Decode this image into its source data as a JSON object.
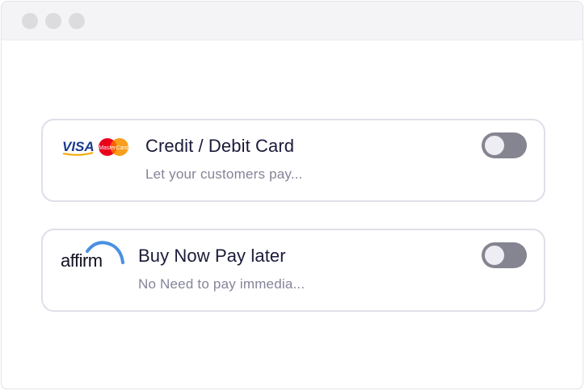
{
  "window": {
    "controls": [
      "close",
      "minimize",
      "maximize"
    ]
  },
  "payment_methods": [
    {
      "title": "Credit / Debit Card",
      "description": "Let your customers pay...",
      "logo": "visa-mastercard-logo",
      "logo_text": {
        "visa": "VISA",
        "mastercard": "MasterCard"
      },
      "enabled": false
    },
    {
      "title": "Buy Now Pay later",
      "description": "No Need to pay immedia...",
      "logo": "affirm-logo",
      "logo_text": {
        "affirm": "affirm"
      },
      "enabled": false
    }
  ],
  "colors": {
    "toggle_off": "#858591",
    "title_text": "#1a1a3a",
    "description_text": "#84849a",
    "visa_blue": "#1a3a8f",
    "visa_gold": "#f2a900",
    "mastercard_red": "#eb001b",
    "mastercard_orange": "#f79e1b",
    "affirm_blue": "#4a90e2"
  }
}
